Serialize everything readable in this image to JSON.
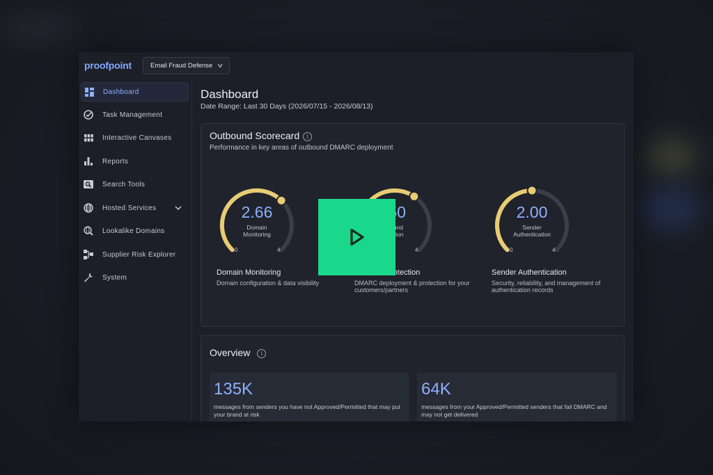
{
  "brand": {
    "logo_text": "proofpoint",
    "accent": "#7ea7ff",
    "gauge_color": "#e7cc73",
    "overlay_color": "#19d88b"
  },
  "topbar": {
    "product_select": "Email Fraud Defense"
  },
  "sidebar": {
    "items": [
      {
        "label": "Dashboard",
        "icon": "dashboard-icon",
        "active": true
      },
      {
        "label": "Task Management",
        "icon": "check-circle-icon"
      },
      {
        "label": "Interactive Canvases",
        "icon": "grid-icon"
      },
      {
        "label": "Reports",
        "icon": "bar-chart-icon"
      },
      {
        "label": "Search Tools",
        "icon": "search-tool-icon"
      },
      {
        "label": "Hosted Services",
        "icon": "globe-icon",
        "expandable": true
      },
      {
        "label": "Lookalike Domains",
        "icon": "magnifier-globe-icon"
      },
      {
        "label": "Supplier Risk Explorer",
        "icon": "network-icon"
      },
      {
        "label": "System",
        "icon": "wrench-icon"
      }
    ]
  },
  "main": {
    "title": "Dashboard",
    "date_range": "Date Range: Last 30 Days (2026/07/15 - 2026/08/13)"
  },
  "scorecard": {
    "title": "Outbound Scorecard",
    "subtitle": "Performance in key areas of outbound DMARC deployment",
    "gauges": [
      {
        "value": "2.66",
        "score": 2.66,
        "max": 4,
        "min_label": "0",
        "max_label": "4",
        "label": "Domain\nMonitoring",
        "title": "Domain Monitoring",
        "desc": "Domain configuration & data visibility"
      },
      {
        "value": ".50",
        "score": 2.5,
        "max": 4,
        "min_label": "0",
        "max_label": "4",
        "label": "bound\ntection",
        "title": "rotection",
        "desc": "DMARC deployment & protection for your customers/partners"
      },
      {
        "value": "2.00",
        "score": 2.0,
        "max": 4,
        "min_label": "0",
        "max_label": "4",
        "label": "Sender\nAuthentication",
        "title": "Sender Authentication",
        "desc": "Security, reliability, and management of authentication records"
      }
    ]
  },
  "overview": {
    "title": "Overview",
    "stats": [
      {
        "value": "135K",
        "desc": "messages from senders you have not Approved/Permitted that may put your brand at risk"
      },
      {
        "value": "64K",
        "desc": "messages from your Approved/Permitted senders that fail DMARC and may not get delivered"
      }
    ]
  },
  "video_overlay": {
    "icon": "play-icon"
  }
}
